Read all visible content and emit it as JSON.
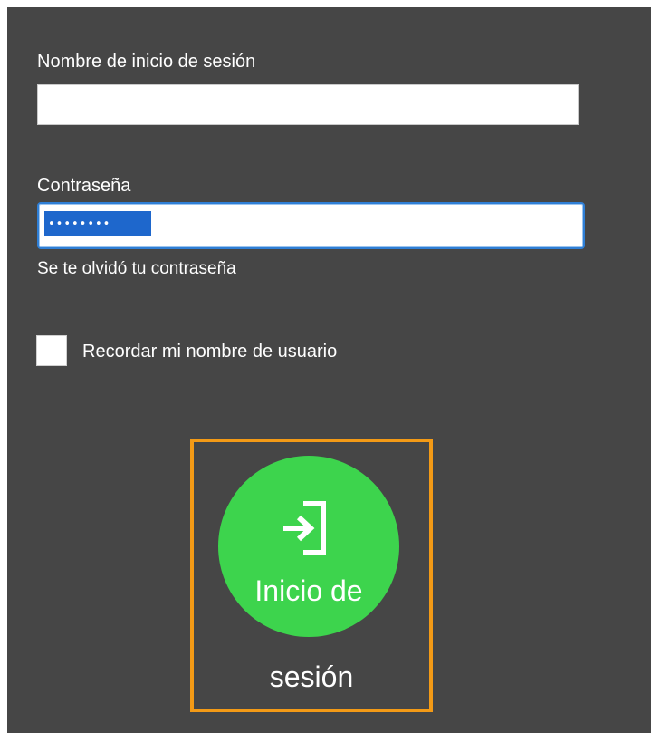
{
  "login_form": {
    "username_label": "Nombre de inicio de sesión",
    "username_value": "",
    "password_label": "Contraseña",
    "password_masked": "••••••••",
    "forgot_password_link": "Se te olvidó tu contraseña",
    "remember_label": "Recordar mi nombre de usuario",
    "remember_checked": false
  },
  "login_button": {
    "label_line1": "Inicio de",
    "label_line2": "sesión",
    "icon": "sign-in-icon"
  },
  "colors": {
    "panel_background": "#464646",
    "login_button": "#3dd44d",
    "highlight_outline": "#f39a16",
    "selection": "#1e67cc",
    "focus_border": "#2f7fd6"
  }
}
